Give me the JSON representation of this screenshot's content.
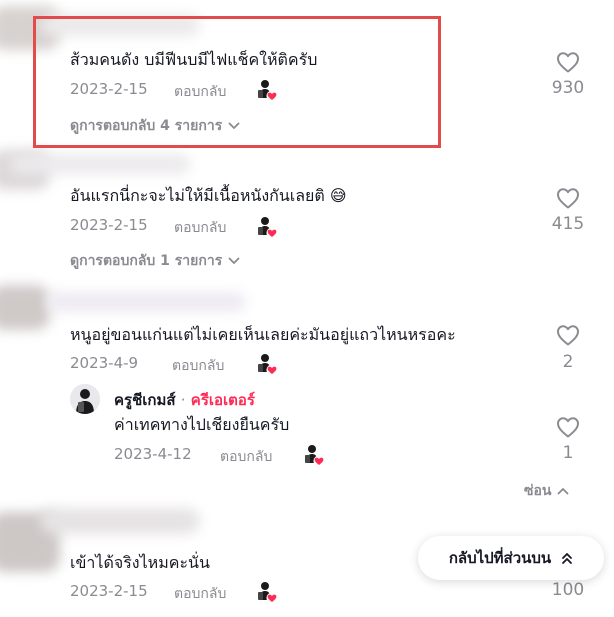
{
  "comments": [
    {
      "text": "ส้วมคนดัง บมีฟีนบมีไฟแช็คให้ติครับ",
      "date": "2023-2-15",
      "reply_label": "ตอบกลับ",
      "likes": "930",
      "view_replies": "ดูการตอบกลับ 4 รายการ"
    },
    {
      "text": "อันแรกนี่กะจะไม่ให้มีเนื้อหนังกันเลยติ",
      "emoji": "😅",
      "date": "2023-2-15",
      "reply_label": "ตอบกลับ",
      "likes": "415",
      "view_replies": "ดูการตอบกลับ 1 รายการ"
    },
    {
      "text": "หนูอยู่ขอนแก่นแต่ไม่เคยเห็นเลยค่ะมันอยู่แถวไหนหรอคะ",
      "date": "2023-4-9",
      "reply_label": "ตอบกลับ",
      "likes": "2",
      "replies": [
        {
          "author": "ครูชีเกมส์",
          "separator": "·",
          "creator_tag": "ครีเอเตอร์",
          "text": "ค่าเทคทางไปเชียงยืนครับ",
          "date": "2023-4-12",
          "reply_label": "ตอบกลับ",
          "likes": "1"
        }
      ],
      "hide_label": "ซ่อน"
    },
    {
      "text": "เข้าได้จริงไหมคะนั่น",
      "date": "2023-2-15",
      "reply_label": "ตอบกลับ",
      "likes": "100"
    }
  ],
  "back_to_top": "กลับไปที่ส่วนบน",
  "colors": {
    "accent": "#fe2c55",
    "muted": "#8a8b91",
    "text": "#161823",
    "highlight": "#e24b4b"
  },
  "icons": [
    "heart-outline-icon",
    "creator-liked-icon",
    "chevron-down-icon",
    "chevron-up-icon",
    "double-chevron-up-icon"
  ]
}
